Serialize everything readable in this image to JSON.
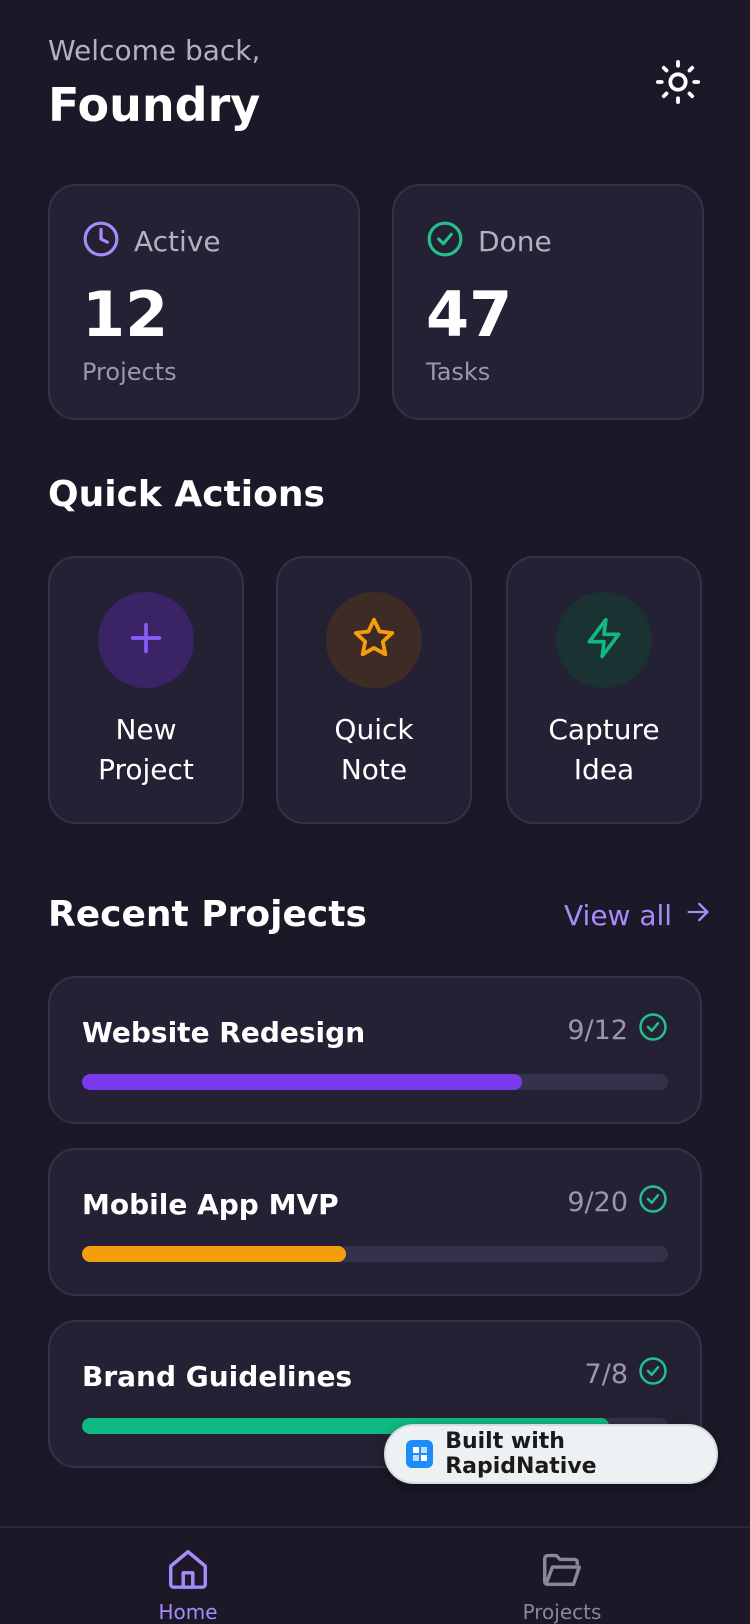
{
  "header": {
    "welcome": "Welcome back,",
    "name": "Foundry",
    "theme_icon": "sun-icon"
  },
  "stats": [
    {
      "label": "Active",
      "value": "12",
      "sub": "Projects",
      "icon": "clock-icon",
      "color": "#a78bfa"
    },
    {
      "label": "Done",
      "value": "47",
      "sub": "Tasks",
      "icon": "check-circle-icon",
      "color": "#22c08a"
    }
  ],
  "quick_actions": {
    "title": "Quick Actions",
    "items": [
      {
        "label": "New Project",
        "icon": "plus-icon",
        "color": "#8b5cf6",
        "bg": "#3b2466"
      },
      {
        "label": "Quick Note",
        "icon": "star-icon",
        "color": "#f59e0b",
        "bg": "#3e2b25"
      },
      {
        "label": "Capture Idea",
        "icon": "lightning-icon",
        "color": "#10b981",
        "bg": "#1b3233"
      }
    ]
  },
  "recent_projects": {
    "title": "Recent Projects",
    "view_all": "View all",
    "items": [
      {
        "name": "Website Redesign",
        "count": "9/12",
        "progress": 0.75,
        "color": "#7c3aed"
      },
      {
        "name": "Mobile App MVP",
        "count": "9/20",
        "progress": 0.45,
        "color": "#f59e0b"
      },
      {
        "name": "Brand Guidelines",
        "count": "7/8",
        "progress": 0.9,
        "color": "#10b981"
      }
    ]
  },
  "badge": {
    "text": "Built with RapidNative"
  },
  "nav": {
    "home": "Home",
    "projects": "Projects",
    "active_color": "#a78bfa"
  }
}
